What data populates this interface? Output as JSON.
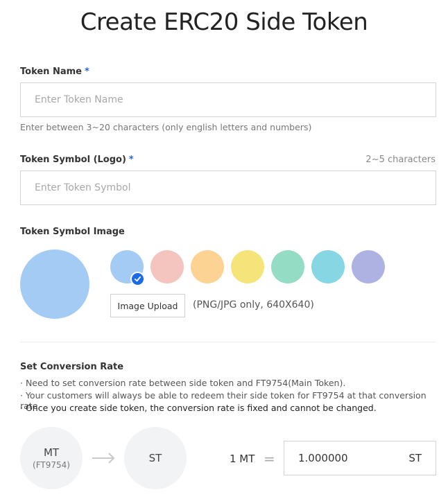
{
  "page_title": "Create ERC20 Side Token",
  "token_name": {
    "label": "Token Name",
    "required_mark": "*",
    "placeholder": "Enter Token Name",
    "value": "",
    "helper": "Enter between 3~20 characters (only english letters and numbers)"
  },
  "token_symbol": {
    "label": "Token Symbol (Logo)",
    "required_mark": "*",
    "char_hint": "2~5 characters",
    "placeholder": "Enter Token Symbol",
    "value": ""
  },
  "symbol_image": {
    "label": "Token Symbol Image",
    "preview_color": "#a3cbf3",
    "swatches": [
      {
        "color": "#a3cbf3",
        "selected": true
      },
      {
        "color": "#f4c4bf",
        "selected": false
      },
      {
        "color": "#fdd394",
        "selected": false
      },
      {
        "color": "#f5e47a",
        "selected": false
      },
      {
        "color": "#94dcc3",
        "selected": false
      },
      {
        "color": "#86d6e4",
        "selected": false
      },
      {
        "color": "#adb2e2",
        "selected": false
      }
    ],
    "upload_label": "Image Upload",
    "upload_note": "(PNG/JPG only, 640X640)"
  },
  "conversion": {
    "label": "Set Conversion Rate",
    "notes": [
      "· Need to set conversion rate between side token and FT9754(Main Token).",
      "· Your customers will always be able to redeem their side token for FT9754 at that conversion rate.",
      "· Once you create side token, the conversion rate is fixed and cannot be changed."
    ],
    "main_token": "MT",
    "main_token_sub": "(FT9754)",
    "side_token": "ST",
    "left_expr": "1 MT",
    "equals": "=",
    "rate_value": "1.000000",
    "rate_unit": "ST"
  },
  "accent_color": "#1b6be8"
}
